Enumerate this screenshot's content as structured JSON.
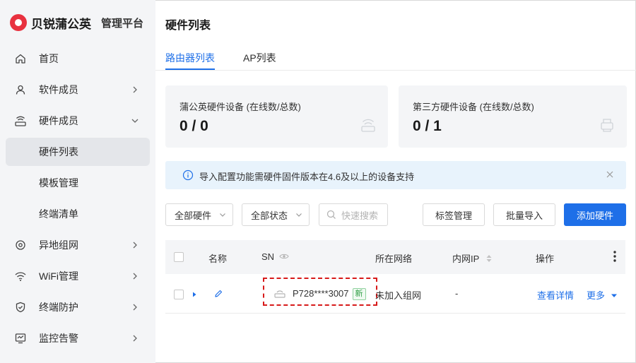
{
  "brand": {
    "name": "贝锐蒲公英",
    "subtitle": "管理平台"
  },
  "sidebar": {
    "items": [
      {
        "label": "首页",
        "icon": "home-icon"
      },
      {
        "label": "软件成员",
        "icon": "user-icon"
      },
      {
        "label": "硬件成员",
        "icon": "router-icon"
      },
      {
        "label": "硬件列表",
        "active": true
      },
      {
        "label": "模板管理"
      },
      {
        "label": "终端清单"
      },
      {
        "label": "异地组网",
        "icon": "network-icon"
      },
      {
        "label": "WiFi管理",
        "icon": "wifi-icon"
      },
      {
        "label": "终端防护",
        "icon": "shield-icon"
      },
      {
        "label": "监控告警",
        "icon": "monitor-icon"
      }
    ]
  },
  "page": {
    "title": "硬件列表"
  },
  "tabs": [
    {
      "label": "路由器列表",
      "active": true
    },
    {
      "label": "AP列表"
    }
  ],
  "stats": [
    {
      "title": "蒲公英硬件设备 (在线数/总数)",
      "value": "0 / 0",
      "icon": "router-icon"
    },
    {
      "title": "第三方硬件设备 (在线数/总数)",
      "value": "0 / 1",
      "icon": "printer-icon"
    }
  ],
  "alert": {
    "text": "导入配置功能需硬件固件版本在4.6及以上的设备支持",
    "icon": "info-icon"
  },
  "filters": {
    "hardware": "全部硬件",
    "status": "全部状态",
    "search_placeholder": "快速搜索"
  },
  "buttons": {
    "tag_manage": "标签管理",
    "batch_import": "批量导入",
    "add_hardware": "添加硬件"
  },
  "table": {
    "columns": [
      "名称",
      "SN",
      "所在网络",
      "内网IP",
      "操作"
    ],
    "rows": [
      {
        "sn": "P728****3007",
        "badge": "新",
        "network": "未加入组网",
        "ip": "-",
        "action_detail": "查看详情",
        "action_more": "更多"
      }
    ]
  },
  "colors": {
    "accent": "#1e6fe8",
    "brand": "#e8313f",
    "highlight": "#d71a1a"
  }
}
